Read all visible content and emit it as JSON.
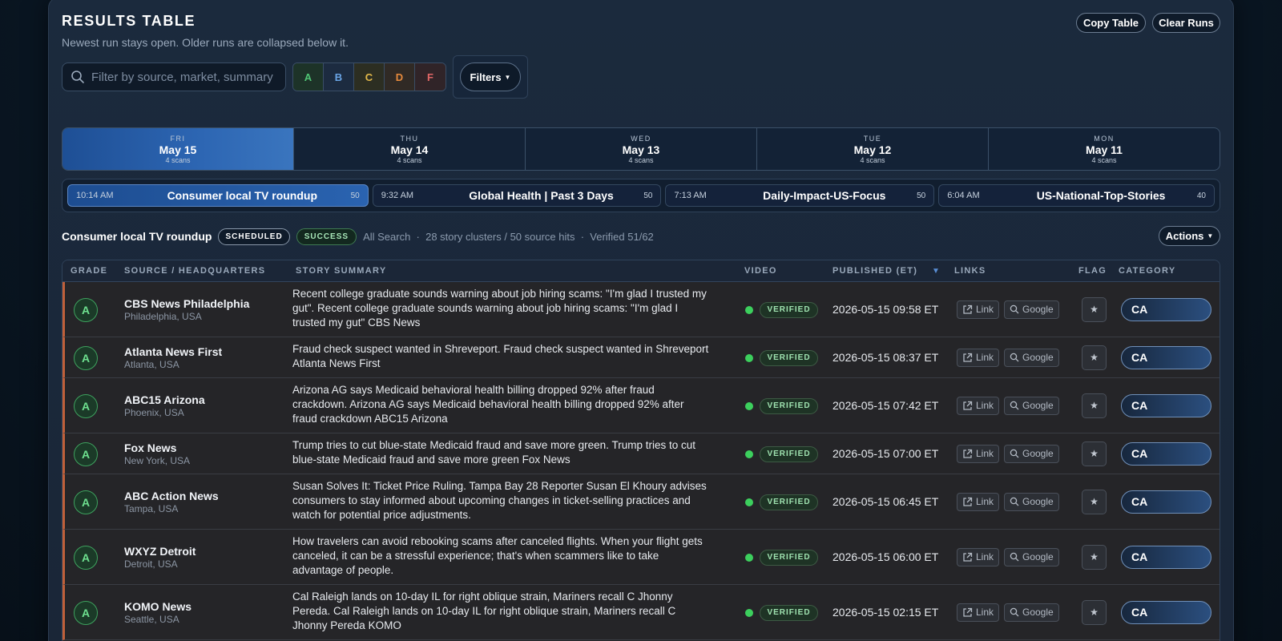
{
  "header": {
    "title": "RESULTS TABLE",
    "subtitle": "Newest run stays open. Older runs are collapsed below it.",
    "copy_table": "Copy Table",
    "clear_runs": "Clear Runs"
  },
  "search": {
    "placeholder": "Filter by source, market, summary",
    "value": ""
  },
  "grade_filters": [
    {
      "label": "A",
      "color": "#4fc474"
    },
    {
      "label": "B",
      "color": "#6aa5e6"
    },
    {
      "label": "C",
      "color": "#e3b94a"
    },
    {
      "label": "D",
      "color": "#e68a3c"
    },
    {
      "label": "F",
      "color": "#e06666"
    }
  ],
  "filters_label": "Filters",
  "days": [
    {
      "dow": "FRI",
      "date": "May 15",
      "scans": "4 scans",
      "active": true
    },
    {
      "dow": "THU",
      "date": "May 14",
      "scans": "4 scans"
    },
    {
      "dow": "WED",
      "date": "May 13",
      "scans": "4 scans"
    },
    {
      "dow": "TUE",
      "date": "May 12",
      "scans": "4 scans"
    },
    {
      "dow": "MON",
      "date": "May 11",
      "scans": "4 scans"
    }
  ],
  "runs": [
    {
      "time": "10:14 AM",
      "name": "Consumer local TV roundup",
      "count": "50",
      "active": true
    },
    {
      "time": "9:32 AM",
      "name": "Global Health | Past 3 Days",
      "count": "50"
    },
    {
      "time": "7:13 AM",
      "name": "Daily-Impact-US-Focus",
      "count": "50"
    },
    {
      "time": "6:04 AM",
      "name": "US-National-Top-Stories",
      "count": "40"
    }
  ],
  "run_header": {
    "title": "Consumer local TV roundup",
    "scheduled": "SCHEDULED",
    "status": "SUCCESS",
    "meta": "All Search  ·  28 story clusters / 50 source hits  ·  Verified 51/62",
    "actions": "Actions"
  },
  "columns": {
    "grade": "GRADE",
    "source": "SOURCE / HEADQUARTERS",
    "summary": "STORY SUMMARY",
    "video": "VIDEO",
    "published": "PUBLISHED (ET)",
    "links": "LINKS",
    "flag": "FLAG",
    "category": "CATEGORY"
  },
  "rows": [
    {
      "grade": "A",
      "source": "CBS News Philadelphia",
      "hq": "Philadelphia, USA",
      "summary": "Recent college graduate sounds warning about job hiring scams: \"I'm glad I trusted my gut\". Recent college graduate sounds warning about job hiring scams: \"I'm glad I trusted my gut\" CBS News",
      "video": "VERIFIED",
      "published": "2026-05-15 09:58 ET",
      "link": "Link",
      "google": "Google",
      "category": "CA"
    },
    {
      "grade": "A",
      "source": "Atlanta News First",
      "hq": "Atlanta, USA",
      "summary": "Fraud check suspect wanted in Shreveport. Fraud check suspect wanted in Shreveport Atlanta News First",
      "video": "VERIFIED",
      "published": "2026-05-15 08:37 ET",
      "link": "Link",
      "google": "Google",
      "category": "CA"
    },
    {
      "grade": "A",
      "source": "ABC15 Arizona",
      "hq": "Phoenix, USA",
      "summary": "Arizona AG says Medicaid behavioral health billing dropped 92% after fraud crackdown. Arizona AG says Medicaid behavioral health billing dropped 92% after fraud crackdown ABC15 Arizona",
      "video": "VERIFIED",
      "published": "2026-05-15 07:42 ET",
      "link": "Link",
      "google": "Google",
      "category": "CA"
    },
    {
      "grade": "A",
      "source": "Fox News",
      "hq": "New York, USA",
      "summary": "Trump tries to cut blue-state Medicaid fraud and save more green. Trump tries to cut blue-state Medicaid fraud and save more green Fox News",
      "video": "VERIFIED",
      "published": "2026-05-15 07:00 ET",
      "link": "Link",
      "google": "Google",
      "category": "CA"
    },
    {
      "grade": "A",
      "source": "ABC Action News",
      "hq": "Tampa, USA",
      "summary": "Susan Solves It: Ticket Price Ruling. Tampa Bay 28 Reporter Susan El Khoury advises consumers to stay informed about upcoming changes in ticket-selling practices and watch for potential price adjustments.",
      "video": "VERIFIED",
      "published": "2026-05-15 06:45 ET",
      "link": "Link",
      "google": "Google",
      "category": "CA"
    },
    {
      "grade": "A",
      "source": "WXYZ Detroit",
      "hq": "Detroit, USA",
      "summary": "How travelers can avoid rebooking scams after canceled flights. When your flight gets canceled, it can be a stressful experience; that's when scammers like to take advantage of people.",
      "video": "VERIFIED",
      "published": "2026-05-15 06:00 ET",
      "link": "Link",
      "google": "Google",
      "category": "CA"
    },
    {
      "grade": "A",
      "source": "KOMO News",
      "hq": "Seattle, USA",
      "summary": "Cal Raleigh lands on 10-day IL for right oblique strain, Mariners recall C Jhonny Pereda. Cal Raleigh lands on 10-day IL for right oblique strain, Mariners recall C Jhonny Pereda KOMO",
      "video": "VERIFIED",
      "published": "2026-05-15 02:15 ET",
      "link": "Link",
      "google": "Google",
      "category": "CA"
    }
  ]
}
